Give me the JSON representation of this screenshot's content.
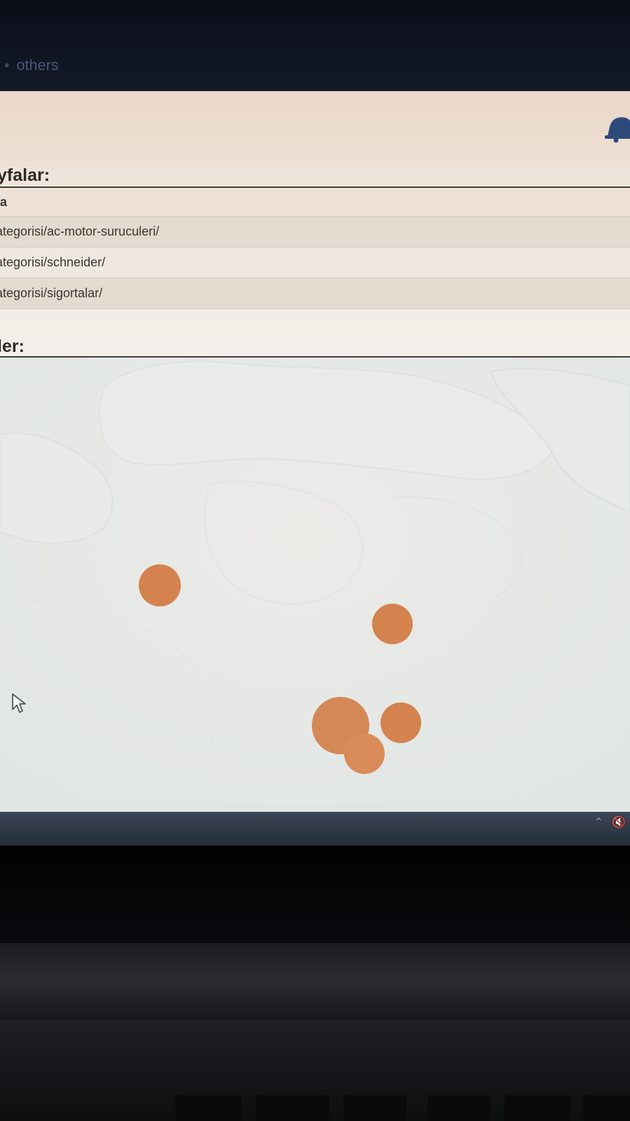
{
  "bookmark_bar": {
    "item_label": "others"
  },
  "pages_section": {
    "title": "yfalar:",
    "column_header": "fa",
    "rows": [
      "ategorisi/ac-motor-suruculeri/",
      "ategorisi/schneider/",
      "ategorisi/sigortalar/"
    ]
  },
  "map_section": {
    "title": "ler:"
  },
  "colors": {
    "marker": "#d4834f",
    "accent_bell": "#2d4a7a"
  },
  "icons": {
    "bell": "bell-icon",
    "cursor": "cursor-icon",
    "tray_up": "chevron-up-icon",
    "tray_volume": "volume-muted-icon"
  }
}
